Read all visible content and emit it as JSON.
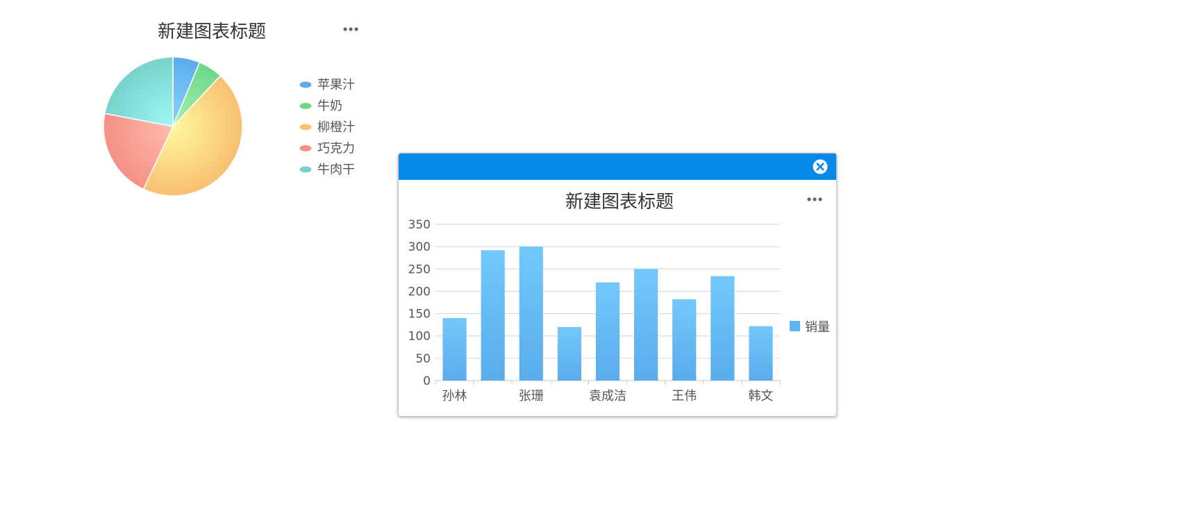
{
  "colors": {
    "popup_header": "#0689e9",
    "bar_top": "#73c8fb",
    "bar_bottom": "#5aacec",
    "menu_dots": "#666666",
    "title_text": "#333333",
    "axis_text": "#555555"
  },
  "icons": {
    "more": "more-horizontal-icon",
    "close": "close-circle-icon"
  },
  "chart_data": [
    {
      "type": "pie",
      "title": "新建图表标题",
      "legend_position": "right",
      "slices": [
        {
          "name": "苹果汁",
          "value": 6.3,
          "color_a": "#8ed4f8",
          "color_b": "#5aacec"
        },
        {
          "name": "牛奶",
          "value": 5.7,
          "color_a": "#a8f0b0",
          "color_b": "#6dd78a"
        },
        {
          "name": "柳橙汁",
          "value": 45.0,
          "color_a": "#fff8a0",
          "color_b": "#f8c070"
        },
        {
          "name": "巧克力",
          "value": 21.0,
          "color_a": "#ffbcac",
          "color_b": "#f59085"
        },
        {
          "name": "牛肉干",
          "value": 22.0,
          "color_a": "#a0f8f4",
          "color_b": "#78d2cc"
        }
      ]
    },
    {
      "type": "bar",
      "title": "新建图表标题",
      "categories": [
        "孙林",
        "",
        "张珊",
        "",
        "袁成洁",
        "",
        "王伟",
        "",
        "韩文"
      ],
      "series": [
        {
          "name": "销量",
          "values": [
            140,
            292,
            300,
            120,
            220,
            250,
            182,
            234,
            122
          ]
        }
      ],
      "ylim": [
        0,
        350
      ],
      "yticks": [
        0,
        50,
        100,
        150,
        200,
        250,
        300,
        350
      ],
      "grid": true,
      "legend_position": "right"
    }
  ]
}
